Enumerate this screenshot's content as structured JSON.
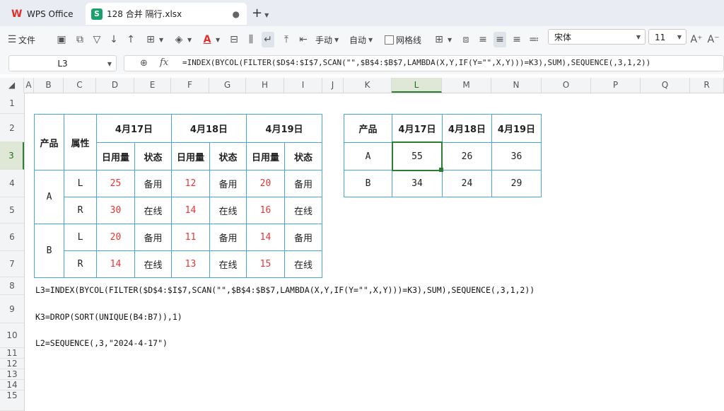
{
  "tabs": {
    "app_label": "WPS Office",
    "file_label": "128 合并 隔行.xlsx",
    "add_label": "+"
  },
  "toolbar": {
    "menu_label": "文件",
    "wrap_label": "手动",
    "auto_label": "自动",
    "gridlines_label": "网格线",
    "font_name": "宋体",
    "font_size": "11",
    "font_color": "#e0302a"
  },
  "formula_bar": {
    "name_box": "L3",
    "fx": "fx",
    "formula": "=INDEX(BYCOL(FILTER($D$4:$I$7,SCAN(\"\",$B$4:$B$7,LAMBDA(X,Y,IF(Y=\"\",X,Y)))=K3),SUM),SEQUENCE(,3,1,2))"
  },
  "columns": [
    "A",
    "B",
    "C",
    "D",
    "E",
    "F",
    "G",
    "H",
    "I",
    "J",
    "K",
    "L",
    "M",
    "N",
    "O",
    "P",
    "Q",
    "R"
  ],
  "rows": [
    "1",
    "2",
    "3",
    "4",
    "5",
    "6",
    "7",
    "8",
    "9",
    "10",
    "11",
    "12",
    "13",
    "14",
    "15"
  ],
  "left_table": {
    "product_header": "产品",
    "attr_header": "属性",
    "dates": [
      "4月17日",
      "4月18日",
      "4月19日"
    ],
    "sub_usage": "日用量",
    "sub_status": "状态",
    "groups": [
      {
        "product": "A",
        "rows": [
          {
            "attr": "L",
            "values": [
              "25",
              "备用",
              "12",
              "备用",
              "20",
              "备用"
            ]
          },
          {
            "attr": "R",
            "values": [
              "30",
              "在线",
              "14",
              "在线",
              "16",
              "在线"
            ]
          }
        ]
      },
      {
        "product": "B",
        "rows": [
          {
            "attr": "L",
            "values": [
              "20",
              "备用",
              "11",
              "备用",
              "14",
              "备用"
            ]
          },
          {
            "attr": "R",
            "values": [
              "14",
              "在线",
              "13",
              "在线",
              "15",
              "在线"
            ]
          }
        ]
      }
    ]
  },
  "right_table": {
    "product_header": "产品",
    "dates": [
      "4月17日",
      "4月18日",
      "4月19日"
    ],
    "rows": [
      {
        "product": "A",
        "values": [
          "55",
          "26",
          "36"
        ]
      },
      {
        "product": "B",
        "values": [
          "34",
          "24",
          "29"
        ]
      }
    ]
  },
  "notes": {
    "l3": "L3=INDEX(BYCOL(FILTER($D$4:$I$7,SCAN(\"\",$B$4:$B$7,LAMBDA(X,Y,IF(Y=\"\",X,Y)))=K3),SUM),SEQUENCE(,3,1,2))",
    "k3": "K3=DROP(SORT(UNIQUE(B4:B7)),1)",
    "l2": "L2=SEQUENCE(,3,\"2024-4-17\")"
  }
}
